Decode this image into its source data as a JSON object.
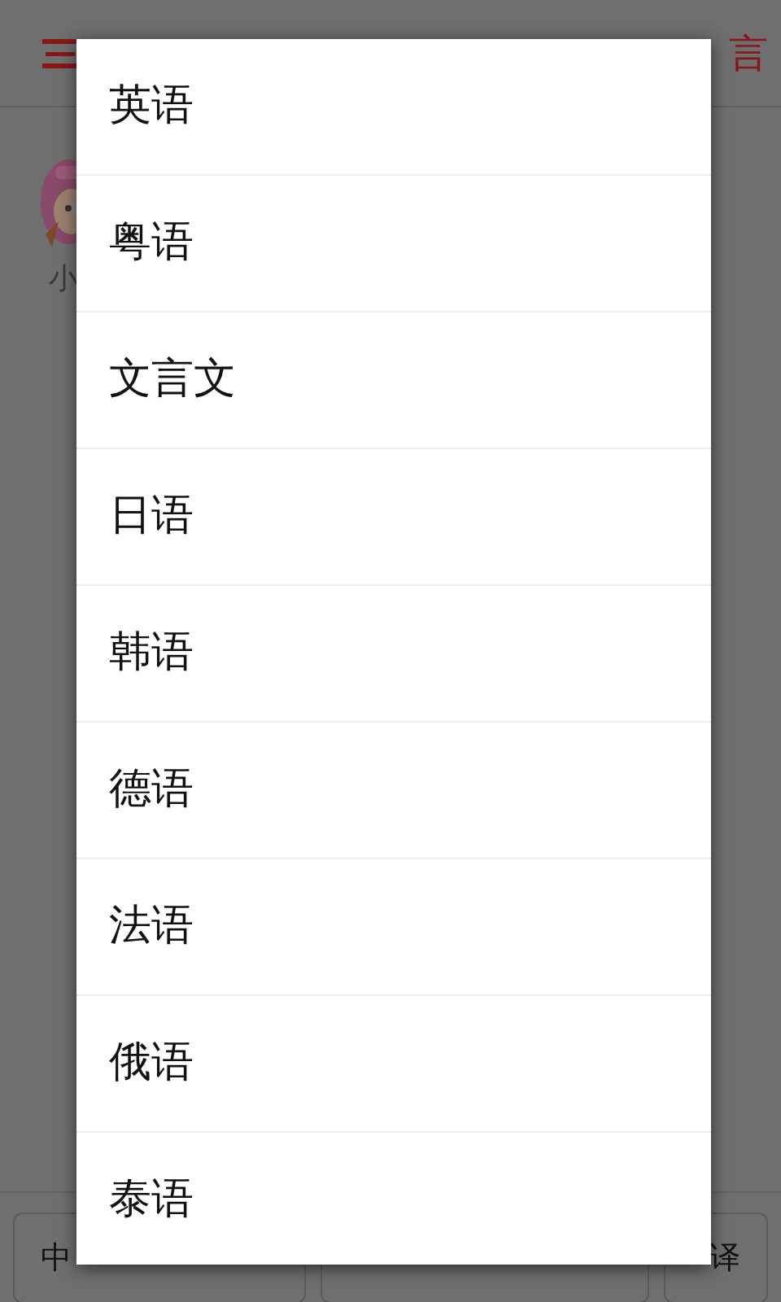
{
  "header": {
    "language_button": "言"
  },
  "profile": {
    "name": "小"
  },
  "bottom_bar": {
    "source_button": "中",
    "translate_button": "译"
  },
  "language_menu": {
    "items": [
      {
        "label": "英语"
      },
      {
        "label": "粤语"
      },
      {
        "label": "文言文"
      },
      {
        "label": "日语"
      },
      {
        "label": "韩语"
      },
      {
        "label": "德语"
      },
      {
        "label": "法语"
      },
      {
        "label": "俄语"
      },
      {
        "label": "泰语"
      }
    ]
  }
}
